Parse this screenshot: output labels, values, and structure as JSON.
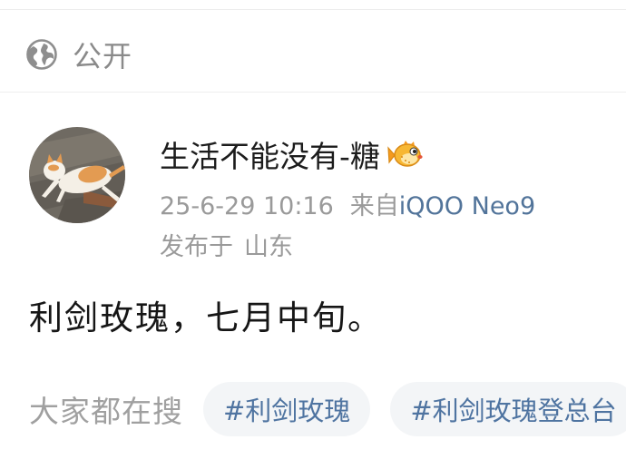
{
  "visibility": {
    "icon": "globe-icon",
    "label": "公开"
  },
  "post": {
    "author": {
      "name": "生活不能没有-糖",
      "avatar": "cat-avatar",
      "badge_icon": "pufferfish-icon"
    },
    "timestamp": "25-6-29 10:16",
    "source_prefix": "来自",
    "device": "iQOO Neo9",
    "location_prefix": "发布于",
    "location": "山东",
    "text": "利剑玫瑰，七月中旬。"
  },
  "search": {
    "label": "大家都在搜",
    "tags": [
      "#利剑玫瑰",
      "#利剑玫瑰登总台"
    ]
  },
  "colors": {
    "link": "#52749a",
    "tag_text": "#4f74a1",
    "tag_bg": "#f3f5f7",
    "muted": "#9a9a9a"
  }
}
